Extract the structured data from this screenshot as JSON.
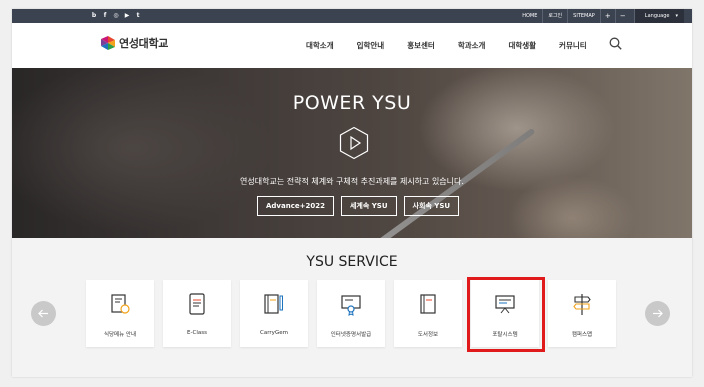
{
  "topbar": {
    "social_icons": [
      "blog-icon",
      "facebook-icon",
      "instagram-icon",
      "youtube-icon",
      "twitter-icon"
    ],
    "social_glyphs": [
      "b",
      "f",
      "◎",
      "▶",
      "t"
    ],
    "links": [
      "HOME",
      "로그인",
      "SITEMAP"
    ],
    "zoom_in": "+",
    "zoom_out": "−",
    "language_label": "Language",
    "language_caret": "▾"
  },
  "header": {
    "logo_text": "연성대학교",
    "nav": [
      "대학소개",
      "입학안내",
      "홍보센터",
      "학과소개",
      "대학생활",
      "커뮤니티"
    ]
  },
  "hero": {
    "title": "POWER YSU",
    "subtitle": "연성대학교는 전략적 체계와 구체적 추진과제를 제시하고 있습니다.",
    "buttons": [
      "Advance+2022",
      "세계속 YSU",
      "사회속 YSU"
    ]
  },
  "service": {
    "title": "YSU SERVICE",
    "items": [
      {
        "label": "식당메뉴 안내",
        "icon": "menu-board-icon"
      },
      {
        "label": "E-Class",
        "icon": "tablet-icon"
      },
      {
        "label": "CarryGem",
        "icon": "notebook-pen-icon"
      },
      {
        "label": "인터넷증명서발급",
        "icon": "certificate-icon"
      },
      {
        "label": "도서정보",
        "icon": "book-icon"
      },
      {
        "label": "포탈시스템",
        "icon": "presentation-board-icon"
      },
      {
        "label": "캠퍼스맵",
        "icon": "signpost-icon"
      }
    ],
    "highlight_color": "#e01a1a"
  },
  "colors": {
    "topbar": "#3b4250",
    "accent_highlight": "#e01a1a",
    "service_bg": "#f3f3f3"
  }
}
